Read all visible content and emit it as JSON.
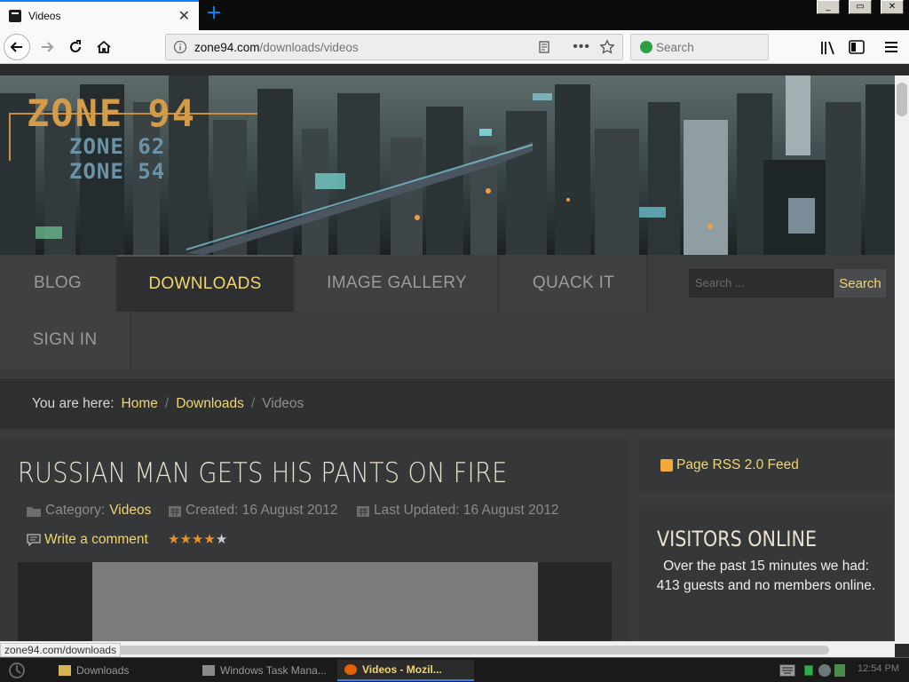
{
  "browser": {
    "tab_title": "Videos",
    "tab_close": "✕",
    "new_tab": "+",
    "url_prefix": "zone94.com",
    "url_path": "/downloads/videos",
    "search_placeholder": "Search",
    "accent": "#0a84ff"
  },
  "hero": {
    "logo_main": "ZONE 94",
    "logo_sub1": "ZONE 62",
    "logo_sub2": "ZONE 54"
  },
  "nav": {
    "items": [
      {
        "label": "BLOG"
      },
      {
        "label": "DOWNLOADS"
      },
      {
        "label": "IMAGE GALLERY"
      },
      {
        "label": "QUACK IT"
      },
      {
        "label": "SIGN IN"
      }
    ],
    "active_index": 1,
    "search_placeholder": "Search ...",
    "search_button": "Search"
  },
  "breadcrumb": {
    "prefix": "You are here:",
    "items": [
      "Home",
      "Downloads"
    ],
    "separator": "/",
    "current": "Videos"
  },
  "article": {
    "title": "RUSSIAN MAN GETS HIS PANTS ON FIRE",
    "category_label": "Category:",
    "category": "Videos",
    "created": "Created: 16 August 2012",
    "updated": "Last Updated: 16 August 2012",
    "comment_link": "Write a comment",
    "rating": 4,
    "rating_max": 5
  },
  "sidebar": {
    "rss_label": "Page RSS 2.0 Feed",
    "visitors_title": "VISITORS ONLINE",
    "visitors_text": "Over the past 15 minutes we had: 413 guests and no members online."
  },
  "status": {
    "url": "zone94.com/downloads"
  },
  "taskbar": {
    "tasks": [
      {
        "label": "Downloads"
      },
      {
        "label": "Windows Task Mana..."
      },
      {
        "label": "Videos - Mozil..."
      }
    ],
    "clock": "12:54 PM"
  },
  "colors": {
    "accent": "#f1d56f",
    "page_bg": "#3a3b3c",
    "panel_bg": "#363738",
    "star_on": "#e8912a",
    "star_off": "#cccccc"
  }
}
